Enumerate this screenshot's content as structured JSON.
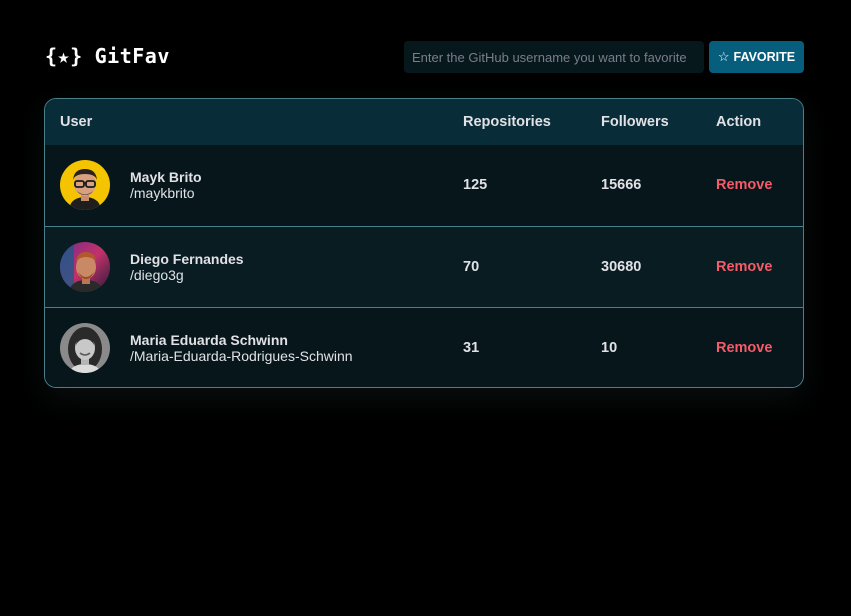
{
  "app": {
    "logo_mark": "{★}",
    "logo_text": "GitFav",
    "logo_icon": "star-braces-icon"
  },
  "search": {
    "placeholder": "Enter the GitHub username you want to favorite",
    "value": ""
  },
  "favorite_button": {
    "icon": "☆",
    "label": "FAVORITE"
  },
  "table": {
    "headers": {
      "user": "User",
      "repositories": "Repositories",
      "followers": "Followers",
      "action": "Action"
    },
    "rows": [
      {
        "name": "Mayk Brito",
        "login": "/maykbrito",
        "repositories": "125",
        "followers": "15666",
        "action": "Remove"
      },
      {
        "name": "Diego Fernandes",
        "login": "/diego3g",
        "repositories": "70",
        "followers": "30680",
        "action": "Remove"
      },
      {
        "name": "Maria Eduarda Schwinn",
        "login": "/Maria-Eduarda-Rodrigues-Schwinn",
        "repositories": "31",
        "followers": "10",
        "action": "Remove"
      }
    ]
  },
  "colors": {
    "background": "#000000",
    "header_row": "#092d38",
    "accent_button": "#065e7c",
    "remove_text": "#f75a68",
    "border": "#4a808c"
  }
}
